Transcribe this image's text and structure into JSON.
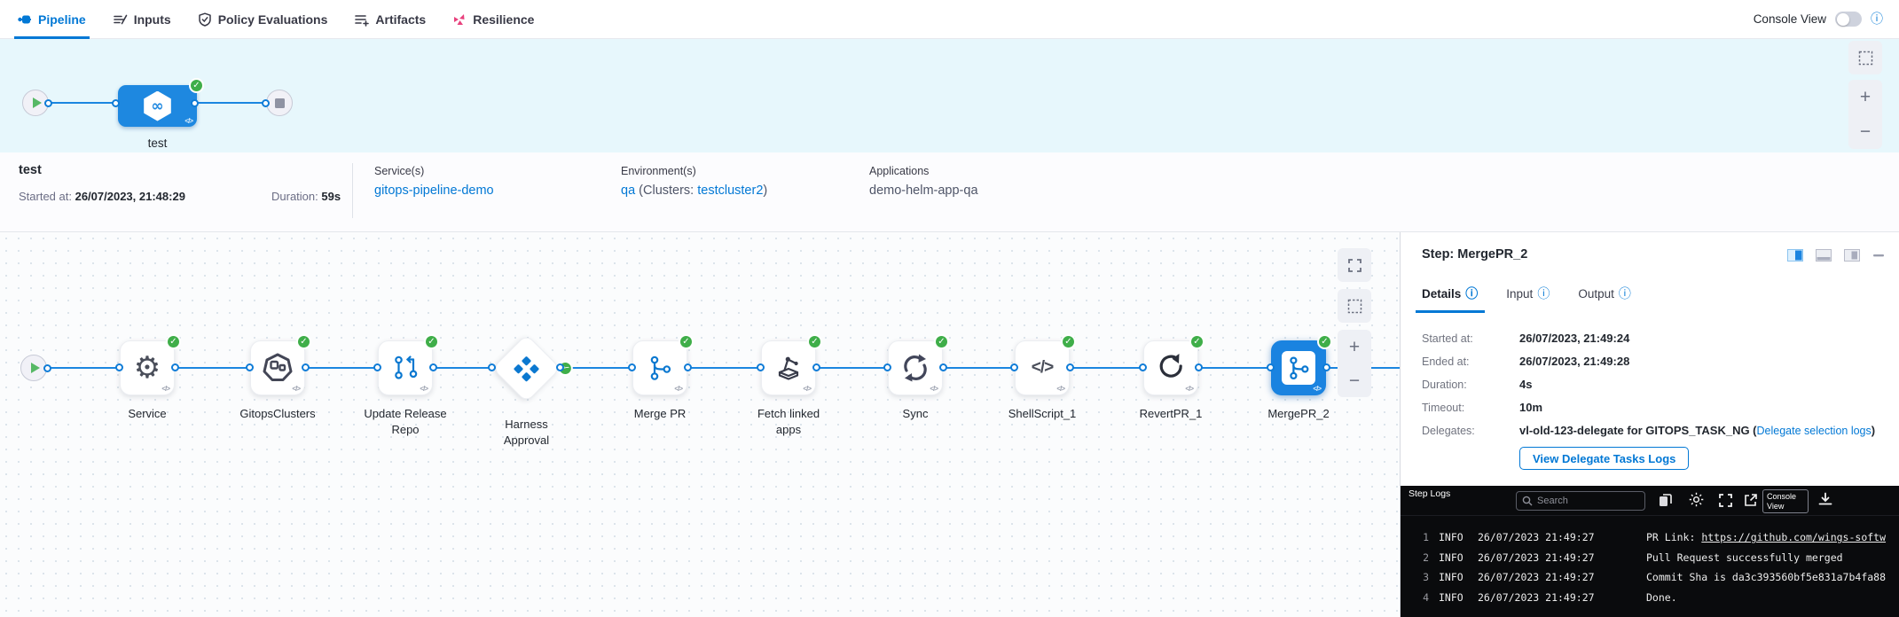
{
  "colors": {
    "accent": "#0278d5",
    "success": "#3fae49",
    "node_blue": "#1a83e0",
    "resilience_pink": "#e8417d"
  },
  "icons": {
    "check": "✓",
    "info": "ⓘ",
    "template": "</>",
    "infinity": "∞",
    "gear": "⚙",
    "plus": "+",
    "minus": "−",
    "code": "</>"
  },
  "topnav": {
    "tabs": [
      {
        "label": "Pipeline",
        "active": true
      },
      {
        "label": "Inputs",
        "active": false
      },
      {
        "label": "Policy Evaluations",
        "active": false
      },
      {
        "label": "Artifacts",
        "active": false
      },
      {
        "label": "Resilience",
        "active": false
      }
    ],
    "console_view_label": "Console View",
    "console_view_on": false
  },
  "stage_band": {
    "stage_label": "test"
  },
  "summary": {
    "name": "test",
    "started_label": "Started at: ",
    "started_value": "26/07/2023, 21:48:29",
    "duration_label": "Duration: ",
    "duration_value": "59s",
    "services_label": "Service(s)",
    "service_link": "gitops-pipeline-demo",
    "environments_label": "Environment(s)",
    "env_link": "qa",
    "env_mid": " (Clusters: ",
    "cluster_link": "testcluster2",
    "env_suffix": ")",
    "applications_label": "Applications",
    "application": "demo-helm-app-qa"
  },
  "graph": {
    "steps": [
      {
        "label": "Service"
      },
      {
        "label": "GitopsClusters"
      },
      {
        "label": "Update Release\nRepo"
      },
      {
        "label": "Harness\nApproval"
      },
      {
        "label": "Merge PR"
      },
      {
        "label": "Fetch linked\napps"
      },
      {
        "label": "Sync"
      },
      {
        "label": "ShellScript_1"
      },
      {
        "label": "RevertPR_1"
      },
      {
        "label": "MergePR_2"
      }
    ]
  },
  "step_panel": {
    "title": "Step: MergePR_2",
    "tabs": [
      {
        "label": "Details"
      },
      {
        "label": "Input"
      },
      {
        "label": "Output"
      }
    ],
    "fields": [
      {
        "label": "Started at:",
        "value": "26/07/2023, 21:49:24"
      },
      {
        "label": "Ended at:",
        "value": "26/07/2023, 21:49:28"
      },
      {
        "label": "Duration:",
        "value": "4s"
      },
      {
        "label": "Timeout:",
        "value": "10m"
      }
    ],
    "delegates_label": "Delegates:",
    "delegates_value": "vl-old-123-delegate for GITOPS_TASK_NG (",
    "delegates_link": "Delegate selection logs",
    "delegates_suffix": ")",
    "view_logs_button": "View Delegate Tasks Logs"
  },
  "console": {
    "title": "Step Logs",
    "search_placeholder": "Search",
    "console_view_button": "Console View",
    "logs": [
      {
        "num": "1",
        "level": "INFO",
        "time": "26/07/2023 21:49:27",
        "prefix": "PR Link: ",
        "link": "https://github.com/wings-softw"
      },
      {
        "num": "2",
        "level": "INFO",
        "time": "26/07/2023 21:49:27",
        "message": "Pull Request successfully merged"
      },
      {
        "num": "3",
        "level": "INFO",
        "time": "26/07/2023 21:49:27",
        "message": "Commit Sha is da3c393560bf5e831a7b4fa88"
      },
      {
        "num": "4",
        "level": "INFO",
        "time": "26/07/2023 21:49:27",
        "message": "Done."
      }
    ]
  }
}
